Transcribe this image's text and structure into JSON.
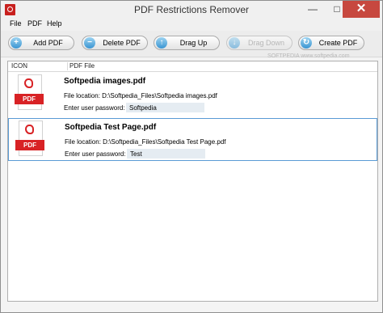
{
  "window": {
    "title": "PDF Restrictions Remover",
    "minimize": "—",
    "maximize": "□",
    "close": "✕"
  },
  "menu": [
    "File",
    "PDF",
    "Help"
  ],
  "toolbar": [
    {
      "label": "Add PDF",
      "icon": "+",
      "icon_name": "add-icon",
      "enabled": true
    },
    {
      "label": "Delete PDF",
      "icon": "−",
      "icon_name": "remove-icon",
      "enabled": true
    },
    {
      "label": "Drag Up",
      "icon": "↑",
      "icon_name": "arrow-up-icon",
      "enabled": true
    },
    {
      "label": "Drag Down",
      "icon": "↓",
      "icon_name": "arrow-down-icon",
      "enabled": false
    },
    {
      "label": "Create PDF",
      "icon": "↻",
      "icon_name": "refresh-icon",
      "enabled": true
    }
  ],
  "watermark": "SOFTPEDIA www.softpedia.com",
  "list": {
    "headers": {
      "icon": "ICON",
      "file": "PDF File"
    },
    "items": [
      {
        "filename": "Softpedia images.pdf",
        "location": "File location: D:\\Softpedia_Files\\Softpedia images.pdf",
        "password_label": "Enter user password:",
        "password": "Softpedia",
        "icon_text": "PDF",
        "selected": false
      },
      {
        "filename": "Softpedia Test Page.pdf",
        "location": "File location: D:\\Softpedia_Files\\Softpedia Test Page.pdf",
        "password_label": "Enter user password:",
        "password": "Test",
        "icon_text": "PDF",
        "selected": true
      }
    ]
  },
  "colors": {
    "accent": "#5a9bd5",
    "pdf_red": "#d82225",
    "close_red": "#c7483f"
  }
}
